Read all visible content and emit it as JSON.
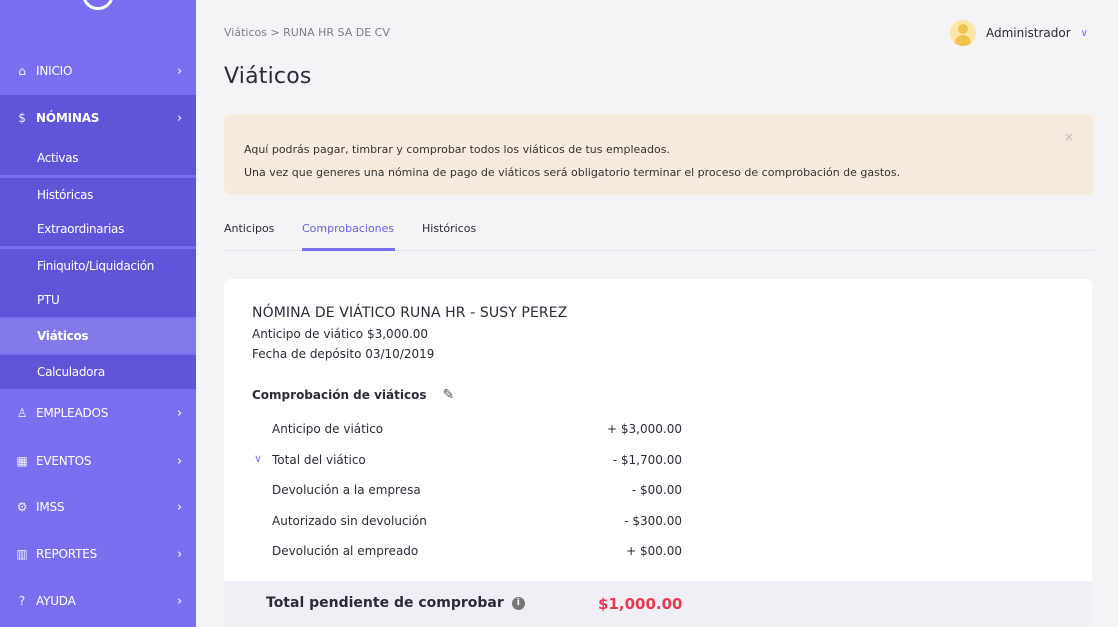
{
  "sidebar": {
    "items": [
      {
        "icon": "home-icon",
        "label": "INICIO"
      },
      {
        "icon": "dollar-icon",
        "label": "NÓMINAS"
      },
      {
        "icon": "user-icon",
        "label": "EMPLEADOS"
      },
      {
        "icon": "calendar-icon",
        "label": "EVENTOS"
      },
      {
        "icon": "gears-icon",
        "label": "IMSS"
      },
      {
        "icon": "chart-icon",
        "label": "REPORTES"
      },
      {
        "icon": "help-icon",
        "label": "AYUDA"
      }
    ],
    "sub_items": [
      "Activas",
      "Históricas",
      "Extraordinarias",
      "Finiquito/Liquidación",
      "PTU",
      "Viáticos",
      "Calculadora"
    ],
    "selected_sub": "Viáticos"
  },
  "header": {
    "breadcrumb": "Viáticos  >  RUNA HR SA DE CV",
    "user": "Administrador",
    "title": "Viáticos"
  },
  "alert": {
    "line1": "Aquí podrás pagar, timbrar y comprobar todos los viáticos de tus empleados.",
    "line2": "Una vez que generes una nómina de pago de viáticos será obligatorio terminar el proceso de comprobación de gastos.",
    "close": "×"
  },
  "tabs": [
    {
      "label": "Anticipos"
    },
    {
      "label": "Comprobaciones"
    },
    {
      "label": "Históricos"
    }
  ],
  "card": {
    "title": "NÓMINA DE VIÁTICO RUNA HR - SUSY PEREZ",
    "advance_label": "Anticipo de viático",
    "advance_value": "$3,000.00",
    "date_label": "Fecha de depósito",
    "date_value": "03/10/2019",
    "section_title": "Comprobación de viáticos",
    "rows": [
      {
        "label": "Anticipo de viático",
        "value": "+ $3,000.00"
      },
      {
        "label": "Total del viático",
        "value": "- $1,700.00"
      },
      {
        "label": "Devolución a la empresa",
        "value": "- $00.00"
      },
      {
        "label": "Autorizado sin devolución",
        "value": "- $300.00"
      },
      {
        "label": "Devolución al empreado",
        "value": "+ $00.00"
      }
    ]
  },
  "total": {
    "label": "Total pendiente de comprobar",
    "value": "$1,000.00",
    "color": "#e63a52"
  },
  "colors": {
    "sidebar": "#7a6ff0",
    "accent": "#6b5fe4",
    "alert_bg": "#f7ebdf"
  }
}
